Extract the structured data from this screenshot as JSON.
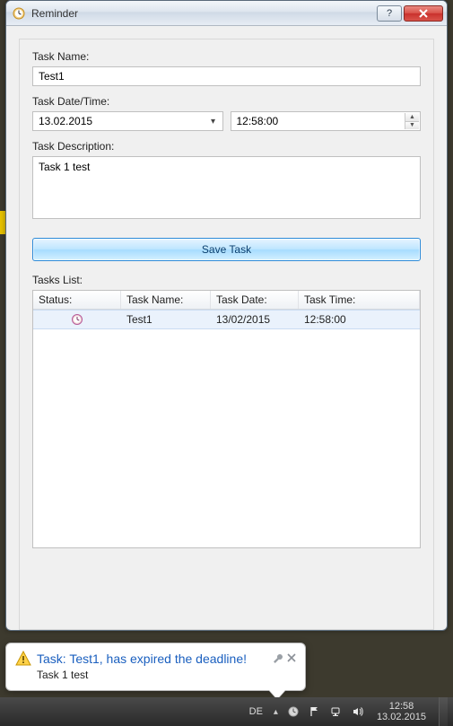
{
  "window": {
    "title": "Reminder"
  },
  "form": {
    "taskNameLabel": "Task Name:",
    "taskNameValue": "Test1",
    "taskDateTimeLabel": "Task Date/Time:",
    "dateValue": "13.02.2015",
    "timeValue": "12:58:00",
    "taskDescriptionLabel": "Task Description:",
    "descriptionValue": "Task 1 test",
    "saveButtonLabel": "Save Task",
    "tasksListLabel": "Tasks List:"
  },
  "grid": {
    "headers": {
      "status": "Status:",
      "name": "Task Name:",
      "date": "Task Date:",
      "time": "Task Time:"
    },
    "rows": [
      {
        "statusIcon": "clock-expired-icon",
        "name": "Test1",
        "date": "13/02/2015",
        "time": "12:58:00"
      }
    ]
  },
  "balloon": {
    "title": "Task: Test1, has expired the deadline!",
    "body": "Task 1 test"
  },
  "taskbar": {
    "lang": "DE",
    "time": "12:58",
    "date": "13.02.2015"
  }
}
